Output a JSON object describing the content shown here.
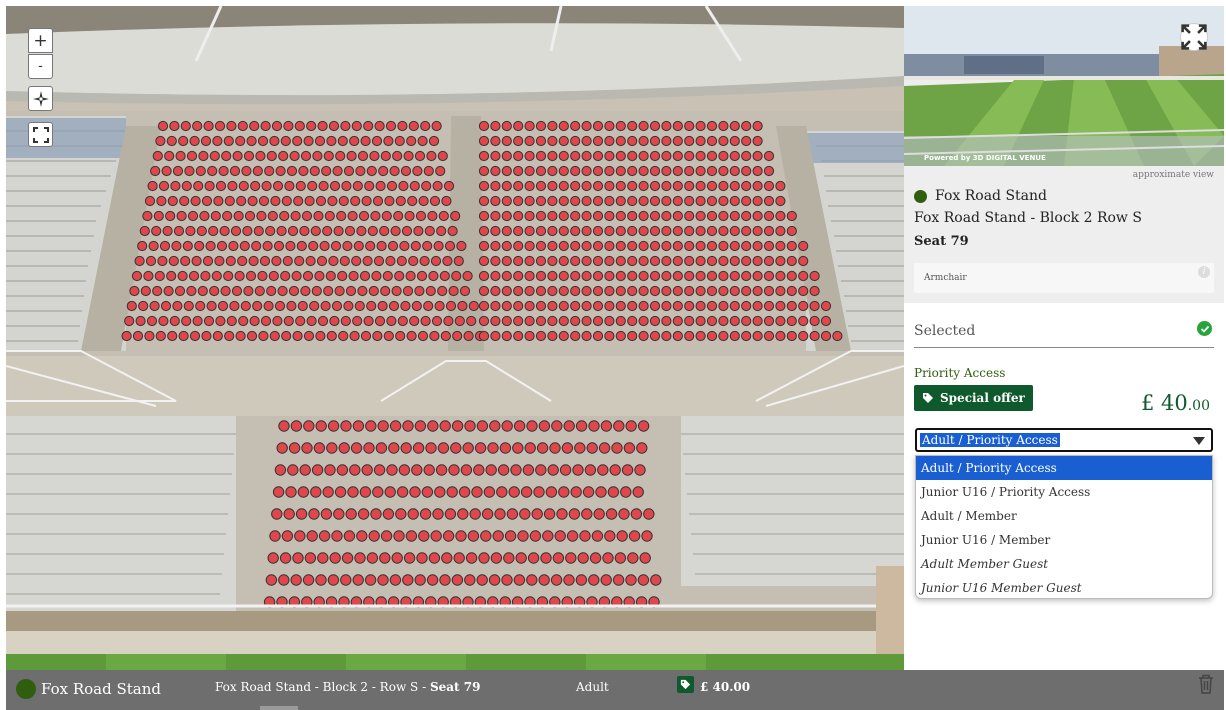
{
  "map": {
    "zoom_in": "+",
    "zoom_out": "-"
  },
  "preview": {
    "powered_by": "Powered by 3D DIGITAL VENUE",
    "approximate": "approximate view"
  },
  "seat": {
    "stand": "Fox Road Stand",
    "block_row": "Fox Road Stand - Block 2 Row S",
    "seat": "Seat 79",
    "feature": "Armchair"
  },
  "selection": {
    "title": "Selected",
    "price_label": "Priority Access",
    "offer_label": "Special offer",
    "price_currency": "£ 40",
    "price_cents": ".00",
    "selected_option": "Adult / Priority Access",
    "options": [
      "Adult / Priority Access",
      "Junior U16 / Priority Access",
      "Adult / Member",
      "Junior U16 / Member",
      "Adult Member Guest",
      "Junior U16 Member Guest"
    ]
  },
  "bottom_bar": {
    "stand": "Fox Road Stand",
    "location": "Fox Road Stand - Block 2 - Row S - ",
    "seat": "Seat 79",
    "ticket_type": "Adult",
    "price": "£ 40.00"
  },
  "colors": {
    "brand_green": "#0f5a2c",
    "stand_dot": "#2f5e0f",
    "highlight_blue": "#1a5fd1",
    "available_seat": "#e0474c",
    "check_green": "#27a53b"
  }
}
